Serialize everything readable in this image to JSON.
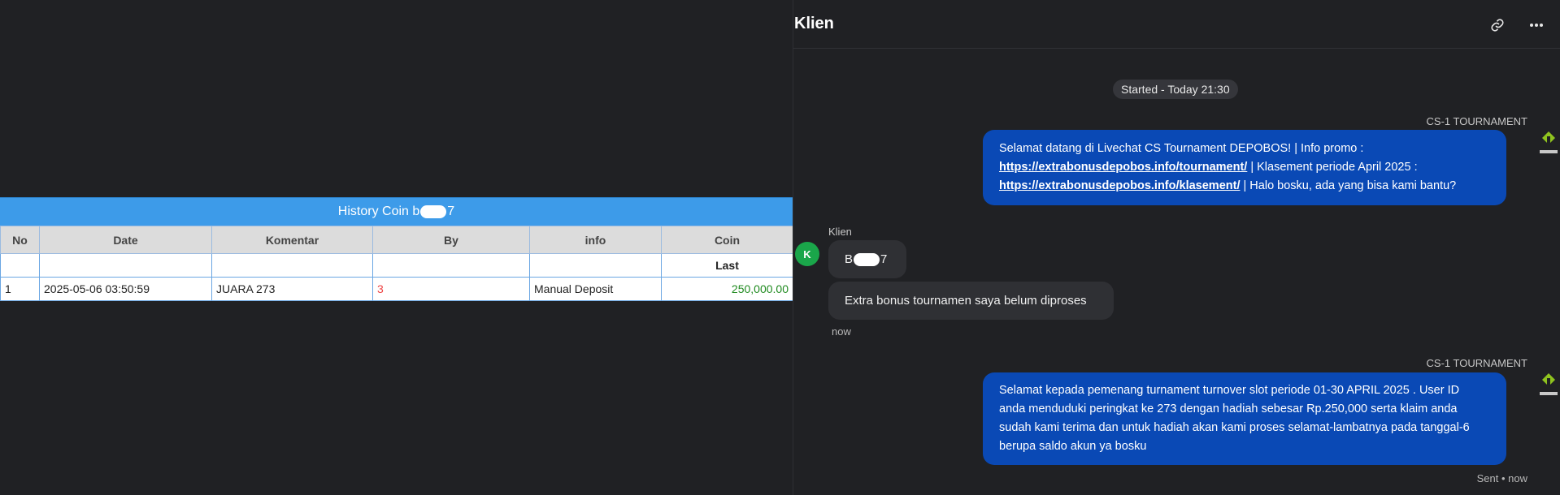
{
  "history": {
    "title_prefix": "History Coin b",
    "title_suffix": "7",
    "columns": [
      "No",
      "Date",
      "Komentar",
      "By",
      "info",
      "Coin"
    ],
    "last_label": "Last",
    "rows": [
      {
        "no": "1",
        "date": "2025-05-06 03:50:59",
        "komentar": "JUARA 273",
        "by": "3",
        "info": "Manual Deposit",
        "coin": "250,000.00"
      }
    ]
  },
  "chat": {
    "title": "Klien",
    "started": "Started - Today 21:30",
    "agent_name": "CS-1 TOURNAMENT",
    "client_name": "Klien",
    "client_avatar": "K",
    "msg1": {
      "text1": "Selamat datang di Livechat CS Tournament DEPOBOS! | Info promo :",
      "link1": "https://extrabonusdepobos.info/tournament/",
      "text2": " | Klasement periode April 2025 :",
      "link2": "https://extrabonusdepobos.info/klasement/",
      "text3": " | Halo bosku, ada yang bisa kami bantu?"
    },
    "client_msg1_prefix": "B",
    "client_msg1_suffix": "7",
    "client_msg2": "Extra bonus tournamen saya belum diproses",
    "client_time": "now",
    "msg2": {
      "line1": "Selamat kepada pemenang turnament turnover slot periode 01-30 APRIL 2025 . User ID",
      "line2": "anda menduduki peringkat ke 273 dengan hadiah sebesar Rp.250,000 serta klaim anda",
      "line3": "sudah kami terima dan untuk hadiah akan kami proses selamat-lambatnya pada tanggal-6",
      "line4": "berupa saldo akun ya bosku"
    },
    "sent_status": "Sent • now"
  },
  "icons": {
    "link": "link-icon",
    "more": "more-icon",
    "agent_logo": "depobos-logo"
  },
  "colors": {
    "table_header": "#3d9be9",
    "agent_bubble": "#0a49b5",
    "client_bubble": "#2f3034",
    "avatar": "#1aa64a",
    "coin_value": "#1f8a1f"
  }
}
